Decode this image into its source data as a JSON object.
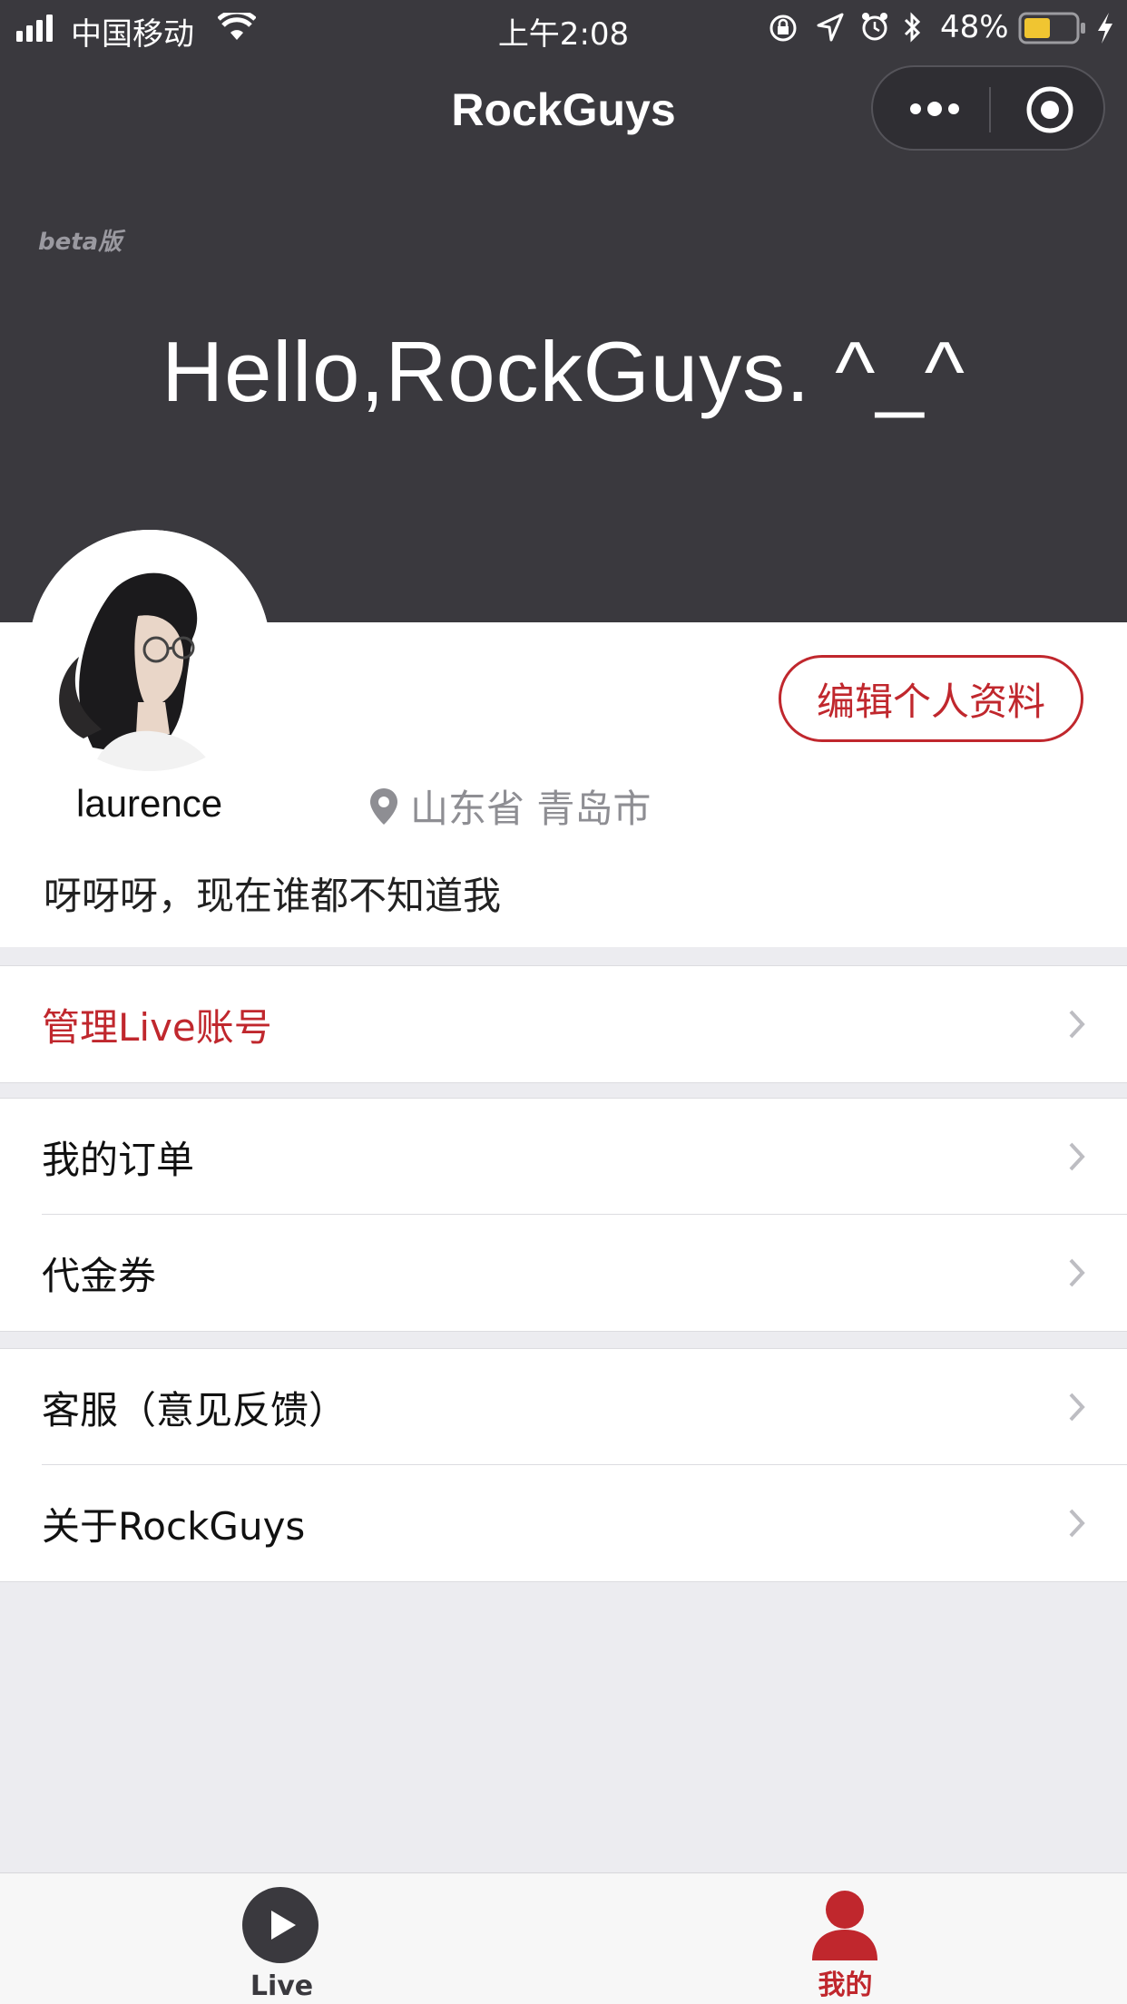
{
  "status_bar": {
    "carrier": "中国移动",
    "time": "上午2:08",
    "battery": "48%"
  },
  "nav": {
    "title": "RockGuys"
  },
  "hero": {
    "beta": "beta版",
    "greeting": "Hello,RockGuys. ^_^"
  },
  "profile": {
    "edit_button": "编辑个人资料",
    "username": "laurence",
    "location": "山东省 青岛市",
    "signature": "呀呀呀，现在谁都不知道我"
  },
  "menu": {
    "manage_live": "管理Live账号",
    "orders": "我的订单",
    "vouchers": "代金券",
    "support": "客服（意见反馈）",
    "about": "关于RockGuys"
  },
  "tabbar": {
    "live": "Live",
    "mine": "我的",
    "active_color": "#c0272d",
    "inactive_color": "#3a393e"
  },
  "colors": {
    "accent": "#c0272d",
    "header_bg": "#3a393e"
  }
}
